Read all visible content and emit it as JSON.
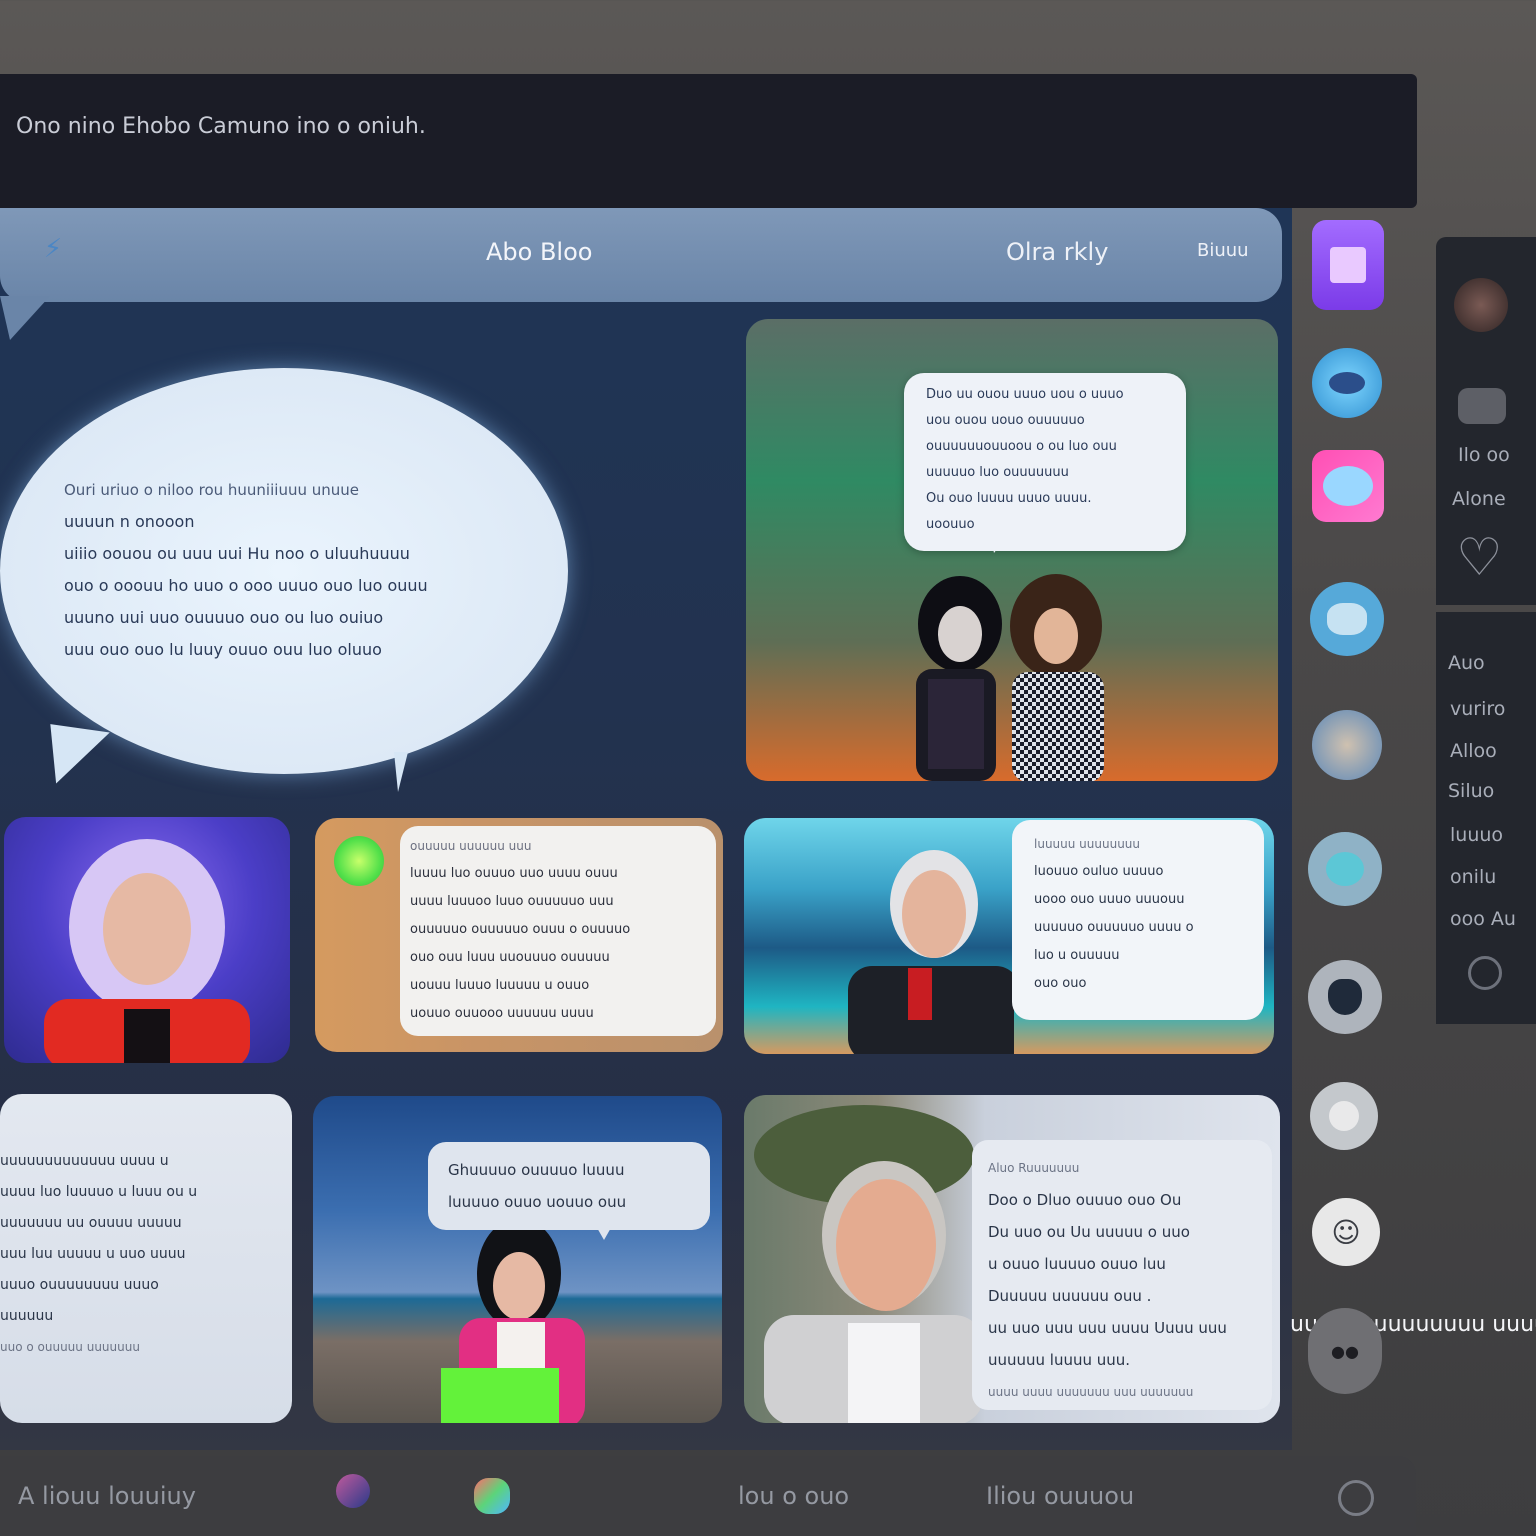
{
  "window": {
    "caption": "Ono nino Ehobo Camuno ino o oniuh."
  },
  "header": {
    "title": "Abo Bloo",
    "right_label": "Olra rkly",
    "button_label": "Biuuu"
  },
  "speech_bubble": {
    "lines": [
      "Ouri uriuo o niloo rou huuniiiuuu unuue",
      "uuuun n onooon",
      "uiiio oouou ou uuu uui Hu noo o uluuhuuuu",
      "ouo o ooouu ho uuo o ooo uuuo ouo luo ouuu",
      "uuuno uui uuo ouuuuo ouo ou luo ouiuo",
      "uuu ouo ouo lu luuy ouuo ouu luo oluuo"
    ]
  },
  "gradient_card": {
    "lines": [
      "Duo uu ouou uuuo uou o uuuo",
      "uou ouou uouo ouuuuuo",
      "ouuuuuuouuoou o ou luo ouu",
      "uuuuuo luo ouuuuuuu",
      "Ou ouo luuuu uuuo uuuu.",
      "uoouuo"
    ]
  },
  "chat_card": {
    "lines": [
      "ouuuuu uuuuuu uuu",
      "luuuu luo ouuuo uuo uuuu ouuu",
      "uuuu luuuoo luuo ouuuuuo uuu",
      "ouuuuuo ouuuuuo ouuu o ouuuuo",
      "ouo ouu luuu uuouuuo ouuuuu",
      "uouuu luuuo luuuuu u ouuo",
      "uouuo ouuooo uuuuuu uuuu"
    ]
  },
  "beach_card": {
    "lines": [
      "luuuuu uuuuuuuu",
      "luouuo ouluo uuuuo",
      "uooo ouo uuuo uuuouu",
      "uuuuuo ouuuuuo uuuu o",
      "luo u ouuuuu",
      "ouo ouo"
    ]
  },
  "text_card": {
    "lines": [
      "uuuuuuuuuuuuu uuuu u",
      "uuuu luo luuuuo u luuu ou u",
      "uuuuuuu uu ouuuu uuuuu",
      "uuu luu uuuuu u uuo uuuu",
      "uuuo ouuuuuuuu uuuo",
      "uuuuuu",
      "uuo o ouuuuu uuuuuuu"
    ]
  },
  "shore_card": {
    "lines": [
      "Ghuuuuo ouuuuo luuuu",
      "luuuuo ouuo uouuo ouu"
    ]
  },
  "elder_card": {
    "lines": [
      "Aluo Ruuuuuuu",
      "Doo o Dluo ouuuo ouo Ou",
      "Du uuo ou Uu uuuuu o uuo",
      "u ouuo luuuuo ouuo luu",
      "Duuuuu uuuuuu ouu .",
      "uu uuo uuu uuu uuuu Uuuu uuu",
      "uuuuuu luuuu uuu.",
      "uuuu uuuu uuuuuuu uuu uuuuuuu"
    ],
    "overflow": "uuuuuuuuuuuuuu uuuu"
  },
  "side_icons": [
    {
      "name": "purple-square-icon",
      "color": "#8b4ff0"
    },
    {
      "name": "fish-icon",
      "color": "#3ab7e8"
    },
    {
      "name": "cloud-icon",
      "color": "#ff4fb4"
    },
    {
      "name": "brain-icon",
      "color": "#56a9d9"
    },
    {
      "name": "people-photo-icon",
      "color": "#5c88b8"
    },
    {
      "name": "teal-blob-icon",
      "color": "#8fb2c6"
    },
    {
      "name": "shield-icon",
      "color": "#2c3c5c"
    },
    {
      "name": "globe-icon",
      "color": "#c4c8cc"
    },
    {
      "name": "emoji-icon",
      "color": "#e8e8e8"
    },
    {
      "name": "robot-icon",
      "color": "#7b7b7f"
    }
  ],
  "right_panel": {
    "items_top": [
      "Ilo oo",
      "Alone"
    ],
    "items_bottom": [
      "Auo",
      "vuriro",
      "Alloo",
      "Siluo",
      "luuuo",
      "onilu",
      "ooo Au"
    ]
  },
  "bottom_bar": {
    "left_label": "A liouu louuiuy",
    "middle_label": "lou o ouo",
    "right_label": "Iliou ouuuou"
  }
}
